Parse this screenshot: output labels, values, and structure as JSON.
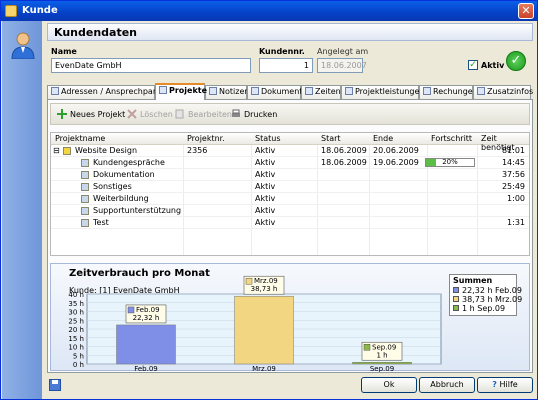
{
  "window": {
    "title": "Kunde",
    "close": "✕"
  },
  "header": {
    "title": "Kundendaten"
  },
  "form": {
    "name_label": "Name",
    "name_value": "EvenDate GmbH",
    "kundennr_label": "Kundennr.",
    "kundennr_value": "1",
    "angelegt_label": "Angelegt am",
    "angelegt_value": "18.06.2007",
    "aktiv_label": "Aktiv",
    "aktiv_checked": "✓",
    "status_icon": "✓"
  },
  "tabs": [
    "Adressen / Ansprechpartner",
    "Projekte",
    "Notizen",
    "Dokumente",
    "Zeiten",
    "Projektleistungen",
    "Rechungen",
    "Zusatzinfos"
  ],
  "toolbar": {
    "new": "Neues Projekt",
    "delete": "Löschen",
    "edit": "Bearbeiten",
    "print": "Drucken"
  },
  "table": {
    "headers": [
      "Projektname",
      "Projektnr.",
      "Status",
      "Start",
      "Ende",
      "Fortschritt",
      "Zeit benötigt"
    ],
    "rows": [
      {
        "expander": "⊟",
        "name": "Website Design",
        "nr": "2356",
        "status": "Aktiv",
        "start": "18.06.2009",
        "end": "20.06.2009",
        "progress": "",
        "time": "81:01"
      },
      {
        "expander": "",
        "name": "Kundengespräche",
        "nr": "",
        "status": "Aktiv",
        "start": "18.06.2009",
        "end": "19.06.2009",
        "progress": "20%",
        "time": "14:45"
      },
      {
        "expander": "",
        "name": "Dokumentation",
        "nr": "",
        "status": "Aktiv",
        "start": "",
        "end": "",
        "progress": "",
        "time": "37:56"
      },
      {
        "expander": "",
        "name": "Sonstiges",
        "nr": "",
        "status": "Aktiv",
        "start": "",
        "end": "",
        "progress": "",
        "time": "25:49"
      },
      {
        "expander": "",
        "name": "Weiterbildung",
        "nr": "",
        "status": "Aktiv",
        "start": "",
        "end": "",
        "progress": "",
        "time": "1:00"
      },
      {
        "expander": "",
        "name": "Supportunterstützung",
        "nr": "",
        "status": "Aktiv",
        "start": "",
        "end": "",
        "progress": "",
        "time": ""
      },
      {
        "expander": "",
        "name": "Test",
        "nr": "",
        "status": "Aktiv",
        "start": "",
        "end": "",
        "progress": "",
        "time": "1:31"
      }
    ]
  },
  "chart": {
    "title": "Zeitverbrauch pro Monat",
    "subtitle": "Kunde: [1] EvenDate GmbH",
    "legend_title": "Summen"
  },
  "chart_data": {
    "type": "bar",
    "categories": [
      "Feb.09",
      "Mrz.09",
      "Sep.09"
    ],
    "values": [
      22.32,
      38.73,
      1
    ],
    "value_labels": [
      "22,32 h",
      "38,73 h",
      "1 h"
    ],
    "legend": [
      "22,32 h Feb.09",
      "38,73 h Mrz.09",
      "1 h Sep.09"
    ],
    "colors": [
      "#7f8fe8",
      "#f2d682",
      "#8bb84a"
    ],
    "yticks": [
      "0 h",
      "5 h",
      "10 h",
      "15 h",
      "20 h",
      "25 h",
      "30 h",
      "35 h",
      "40 h"
    ],
    "ylim": [
      0,
      40
    ]
  },
  "buttons": {
    "ok": "Ok",
    "cancel": "Abbruch",
    "help": "Hilfe"
  }
}
